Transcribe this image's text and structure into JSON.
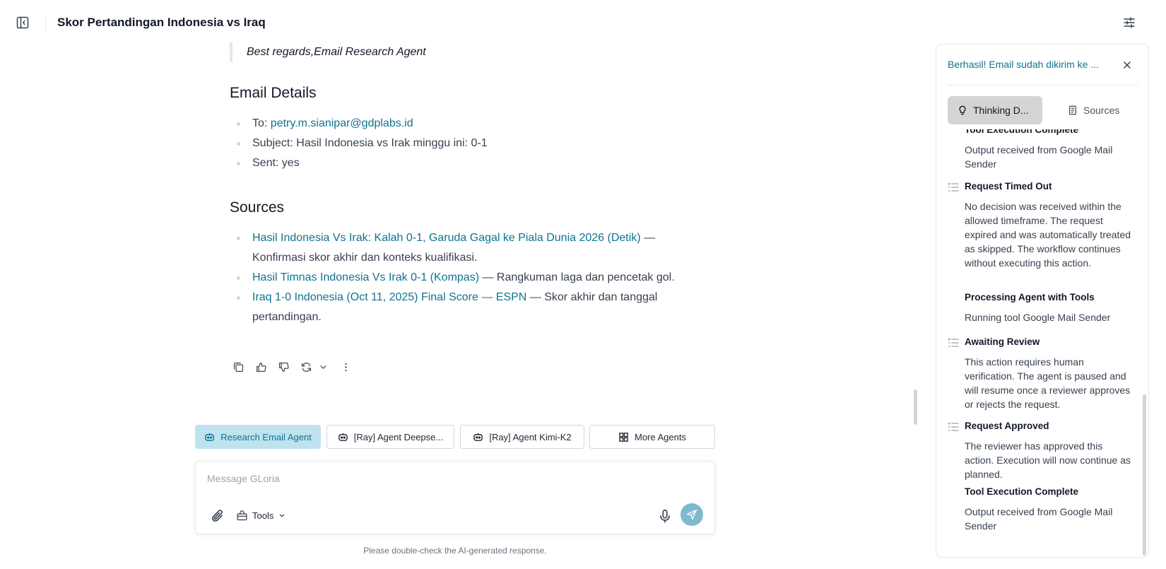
{
  "header": {
    "title": "Skor Pertandingan Indonesia vs Iraq"
  },
  "message": {
    "quote": "Best regards,Email Research Agent",
    "email_details": {
      "heading": "Email Details",
      "to_label": "To: ",
      "to_value": "petry.m.sianipar@gdplabs.id",
      "subject": "Subject: Hasil Indonesia vs Irak minggu ini: 0-1",
      "sent": "Sent: yes"
    },
    "sources": {
      "heading": "Sources",
      "items": [
        {
          "link": "Hasil Indonesia Vs Irak: Kalah 0-1, Garuda Gagal ke Piala Dunia 2026 (Detik)",
          "text": " — Konfirmasi skor akhir dan konteks kualifikasi."
        },
        {
          "link": "Hasil Timnas Indonesia Vs Irak 0-1 (Kompas)",
          "text": " — Rangkuman laga dan pencetak gol."
        },
        {
          "link": "Iraq 1-0 Indonesia (Oct 11, 2025) Final Score — ESPN",
          "text": " — Skor akhir dan tanggal pertandingan."
        }
      ]
    }
  },
  "agents": {
    "chips": [
      {
        "label": "Research Email Agent",
        "icon": "bot-icon",
        "active": true
      },
      {
        "label": "[Ray] Agent Deepse...",
        "icon": "bot-icon",
        "active": false
      },
      {
        "label": "[Ray] Agent Kimi-K2",
        "icon": "bot-icon",
        "active": false
      },
      {
        "label": "More Agents",
        "icon": "grid-icon",
        "active": false
      }
    ]
  },
  "composer": {
    "placeholder": "Message GLoria",
    "tools_label": "Tools",
    "disclaimer": "Please double-check the AI-generated response."
  },
  "panel": {
    "title": "Berhasil! Email sudah dikirim ke ...",
    "tabs": [
      {
        "label": "Thinking D...",
        "icon": "lightbulb-icon",
        "active": true
      },
      {
        "label": "Sources",
        "icon": "document-icon",
        "active": false
      }
    ],
    "timeline": [
      {
        "title": "Tool Execution Complete",
        "desc": "Output received from Google Mail Sender",
        "icon": false
      },
      {
        "title": "Request Timed Out",
        "desc": "No decision was received within the allowed timeframe. The request expired and was automatically treated as skipped. The workflow continues without executing this action.",
        "icon": true
      },
      {
        "title": "Processing Agent with Tools",
        "desc": "Running tool Google Mail Sender",
        "icon": false
      },
      {
        "title": "Awaiting Review",
        "desc": "This action requires human verification. The agent is paused and will resume once a reviewer approves or rejects the request.",
        "icon": true
      },
      {
        "title": "Request Approved",
        "desc": "The reviewer has approved this action. Execution will now continue as planned.",
        "icon": true
      },
      {
        "title": "Tool Execution Complete",
        "desc": "Output received from Google Mail Sender",
        "icon": false
      }
    ]
  },
  "colors": {
    "accent": "#0e7490",
    "active_chip_bg": "#bfe2ef",
    "send_button": "#7fb8cf"
  }
}
